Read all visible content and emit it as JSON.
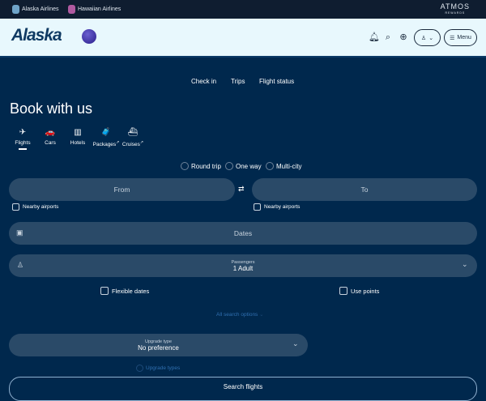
{
  "topbar": {
    "alaska": "Alaska Airlines",
    "hawaiian": "Hawaiian Airlines",
    "atmos": "ATMOS",
    "atmos_sub": "REWARDS"
  },
  "header": {
    "logo": "Alaska",
    "menu": "Menu"
  },
  "nav": [
    "Check in",
    "Trips",
    "Flight status"
  ],
  "title": "Book with us",
  "tabs": [
    {
      "label": "Flights",
      "icon": "✈"
    },
    {
      "label": "Cars",
      "icon": "🚗"
    },
    {
      "label": "Hotels",
      "icon": "▥"
    },
    {
      "label": "Packages",
      "icon": "🧳"
    },
    {
      "label": "Cruises",
      "icon": "⛴"
    }
  ],
  "trip_types": [
    "Round trip",
    "One way",
    "Multi-city"
  ],
  "from": "From",
  "to": "To",
  "nearby": "Nearby airports",
  "dates": "Dates",
  "passengers": {
    "label": "Passengers",
    "value": "1 Adult"
  },
  "flexible": "Flexible dates",
  "points": "Use points",
  "all_options": "All search options",
  "upgrade": {
    "label": "Upgrade type",
    "value": "No preference",
    "link": "Upgrade types"
  },
  "search": "Search flights"
}
